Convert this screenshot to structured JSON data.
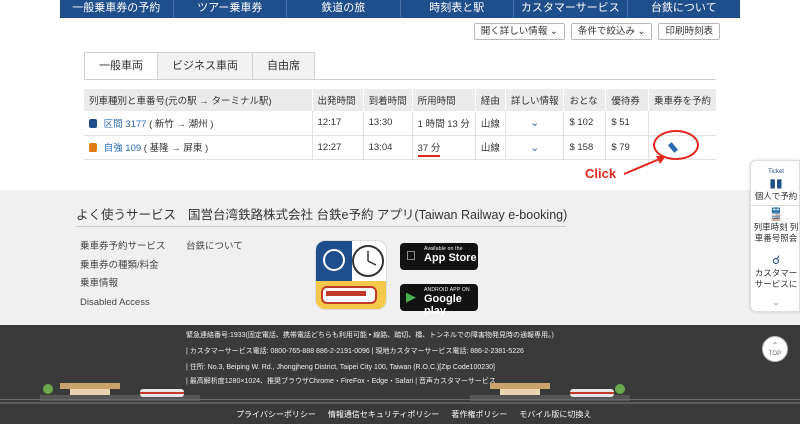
{
  "nav": {
    "items": [
      "一般乗車券の予約",
      "ツアー乗車券",
      "鉄道の旅",
      "時刻表と駅",
      "カスタマーサービス",
      "台鉄について"
    ]
  },
  "toolbar": {
    "more_info": "開く詳しい情報",
    "filter": "条件で絞込み",
    "print": "印刷時刻表"
  },
  "tabs": [
    "一般車両",
    "ビジネス車両",
    "自由席"
  ],
  "table": {
    "headers": [
      "列車種別と車番号(元の駅 → ターミナル駅)",
      "出発時間",
      "到着時間",
      "所用時間",
      "経由",
      "詳しい情報",
      "おとな",
      "優待券",
      "乗車券を予約"
    ],
    "rows": [
      {
        "train": "区間 3177",
        "route": "( 新竹 → 潮州 )",
        "depart": "12:17",
        "arrive": "13:30",
        "duration": "1 時間 13 分",
        "via": "山線",
        "adult": "$ 102",
        "discount": "$ 51",
        "icon_color": "#1f4e8c"
      },
      {
        "train": "自強 109",
        "route": "( 基隆 → 屏東 )",
        "depart": "12:27",
        "arrive": "13:04",
        "duration": "37 分",
        "via": "山線",
        "adult": "$ 158",
        "discount": "$ 79",
        "icon_color": "#e07b1a"
      }
    ]
  },
  "annotation": {
    "click": "Click"
  },
  "services": {
    "title_1": "よく使うサービス",
    "title_2": "国営台湾鉄路株式会社 台鉄e予約 アプリ(Taiwan Railway e-booking)",
    "links_col1": [
      "乗車券予約サービス",
      "乗車券の種類/料金",
      "乗車情報",
      "Disabled Access"
    ],
    "links_col2": [
      "台鉄について"
    ],
    "app_store": {
      "small": "Available on the",
      "big": "App Store"
    },
    "google_play": {
      "small": "ANDROID APP ON",
      "big": "Google play"
    }
  },
  "footer": {
    "line1": "緊急連絡番号:1933(固定電話、携帯電話どちらも利用可能 • 線路、踏切、橋、トンネルでの障害物発見時の通報専用。)",
    "line2": "|   カスタマーサービス電話:  0800-765-888 886-2-2191-0096       |   現地カスタマーサービス電話:  886-2-2381-5226",
    "line3": "|   住所: No.3, Beiping W. Rd., Jhongjheng District, Taipei City 100, Taiwan (R.O.C.)[Zip Code100230]",
    "line4": "|   最高解析度1280×1024、推奨ブラウザChrome・FireFox・Edge・Safari   |   音声カスタマーサービス",
    "nav": [
      "プライバシーポリシー",
      "情報通信セキュリティポリシー",
      "著作権ポリシー",
      "モバイル版に切換え"
    ]
  },
  "side_widget": {
    "ticket_icon_label": "Ticket",
    "item1": "個人で予約",
    "item2": "列車時刻 列車番号照会",
    "item3": "カスタマーサービスに",
    "top": "TOP"
  }
}
